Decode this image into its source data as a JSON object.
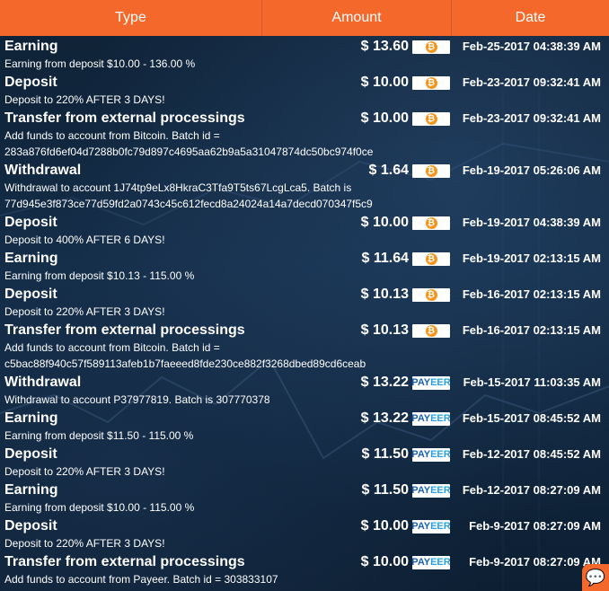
{
  "header": {
    "type": "Type",
    "amount": "Amount",
    "date": "Date"
  },
  "colors": {
    "accent": "#f5682b",
    "bitcoin": "#f7931a",
    "payeer": "#1a5fb4"
  },
  "transactions": [
    {
      "type": "Earning",
      "amount": "$ 13.60",
      "method": "bitcoin",
      "date": "Feb-25-2017 04:38:39 AM",
      "desc": [
        "Earning from deposit $10.00 - 136.00 %"
      ]
    },
    {
      "type": "Deposit",
      "amount": "$ 10.00",
      "method": "bitcoin",
      "date": "Feb-23-2017 09:32:41 AM",
      "desc": [
        "Deposit to 220% AFTER 3 DAYS!"
      ]
    },
    {
      "type": "Transfer from external processings",
      "amount": "$ 10.00",
      "method": "bitcoin",
      "date": "Feb-23-2017 09:32:41 AM",
      "desc": [
        "Add funds to account from Bitcoin. Batch id =",
        "283a876fd6ef04d7288b0fc79d897c4695aa62b9a5a31047874dc50bc974f0ce"
      ]
    },
    {
      "type": "Withdrawal",
      "amount": "$ 1.64",
      "method": "bitcoin",
      "date": "Feb-19-2017 05:26:06 AM",
      "desc": [
        "Withdrawal to account 1J74tp9eLx8HkraC3Tfa9T5ts67LcgLca5. Batch is",
        "77d945e3f873ce77d59fd2a0743c45c612fecd8a24024a14a7decd070347f5c9"
      ]
    },
    {
      "type": "Deposit",
      "amount": "$ 10.00",
      "method": "bitcoin",
      "date": "Feb-19-2017 04:38:39 AM",
      "desc": [
        "Deposit to 400% AFTER 6 DAYS!"
      ]
    },
    {
      "type": "Earning",
      "amount": "$ 11.64",
      "method": "bitcoin",
      "date": "Feb-19-2017 02:13:15 AM",
      "desc": [
        "Earning from deposit $10.13 - 115.00 %"
      ]
    },
    {
      "type": "Deposit",
      "amount": "$ 10.13",
      "method": "bitcoin",
      "date": "Feb-16-2017 02:13:15 AM",
      "desc": [
        "Deposit to 220% AFTER 3 DAYS!"
      ]
    },
    {
      "type": "Transfer from external processings",
      "amount": "$ 10.13",
      "method": "bitcoin",
      "date": "Feb-16-2017 02:13:15 AM",
      "desc": [
        "Add funds to account from Bitcoin. Batch id =",
        "c5bac88f940c57f589113afeb1b7faeeed8fde230ce882f3268dbed89cd6ceab"
      ]
    },
    {
      "type": "Withdrawal",
      "amount": "$ 13.22",
      "method": "payeer",
      "date": "Feb-15-2017 11:03:35 AM",
      "desc": [
        "Withdrawal to account P37977819. Batch is 307770378"
      ]
    },
    {
      "type": "Earning",
      "amount": "$ 13.22",
      "method": "payeer",
      "date": "Feb-15-2017 08:45:52 AM",
      "desc": [
        "Earning from deposit $11.50 - 115.00 %"
      ]
    },
    {
      "type": "Deposit",
      "amount": "$ 11.50",
      "method": "payeer",
      "date": "Feb-12-2017 08:45:52 AM",
      "desc": [
        "Deposit to 220% AFTER 3 DAYS!"
      ]
    },
    {
      "type": "Earning",
      "amount": "$ 11.50",
      "method": "payeer",
      "date": "Feb-12-2017 08:27:09 AM",
      "desc": [
        "Earning from deposit $10.00 - 115.00 %"
      ]
    },
    {
      "type": "Deposit",
      "amount": "$ 10.00",
      "method": "payeer",
      "date": "Feb-9-2017 08:27:09 AM",
      "desc": [
        "Deposit to 220% AFTER 3 DAYS!"
      ]
    },
    {
      "type": "Transfer from external processings",
      "amount": "$ 10.00",
      "method": "payeer",
      "date": "Feb-9-2017 08:27:09 AM",
      "desc": [
        "Add funds to account from Payeer. Batch id = 303833107"
      ]
    }
  ],
  "badges": {
    "bitcoin_symbol": "₿",
    "payeer_left": "PAY",
    "payeer_right": "EER"
  },
  "chat": {
    "icon": "chat-bubble-icon",
    "glyph": "💬"
  }
}
